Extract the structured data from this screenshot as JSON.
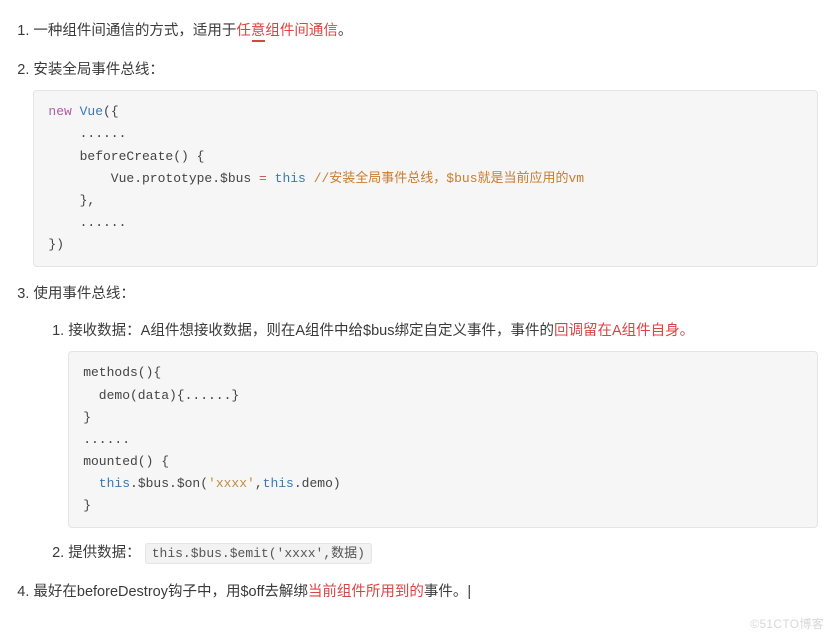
{
  "list": {
    "item1": {
      "prefix": "一种组件间通信的方式，适用于",
      "highlight": "任意组件间通信",
      "suffix": "。"
    },
    "item2": {
      "text": "安装全局事件总线："
    },
    "item3": {
      "text": "使用事件总线："
    },
    "sub1": {
      "prefix": "接收数据：A组件想接收数据，则在A组件中给$bus绑定自定义事件，事件的",
      "highlight": "回调留在A组件自身。"
    },
    "sub2": {
      "label": "提供数据："
    },
    "item4": {
      "prefix": "最好在beforeDestroy钩子中，用$off去解绑",
      "highlight": "当前组件所用到的",
      "suffix": "事件。|"
    }
  },
  "code1": {
    "l1a": "new",
    "l1b": " Vue",
    "l1c": "({",
    "l2": "    ......",
    "l3": "    beforeCreate() {",
    "l4a": "        Vue.prototype.$bus ",
    "l4b": "=",
    "l4c": " ",
    "l4d": "this",
    "l4e": " ",
    "l4f": "//安装全局事件总线，$bus就是当前应用的vm",
    "l5": "    },",
    "l6": "    ......",
    "l7": "})"
  },
  "code2": {
    "l1": "methods(){",
    "l2": "  demo(data){......}",
    "l3": "}",
    "l4": "......",
    "l5": "mounted() {",
    "l6a": "  ",
    "l6b": "this",
    "l6c": ".$bus.$on(",
    "l6d": "'xxxx'",
    "l6e": ",",
    "l6f": "this",
    "l6g": ".demo)",
    "l7": "}"
  },
  "inlineCode": "this.$bus.$emit('xxxx',数据)",
  "watermark": "©51CTO博客"
}
